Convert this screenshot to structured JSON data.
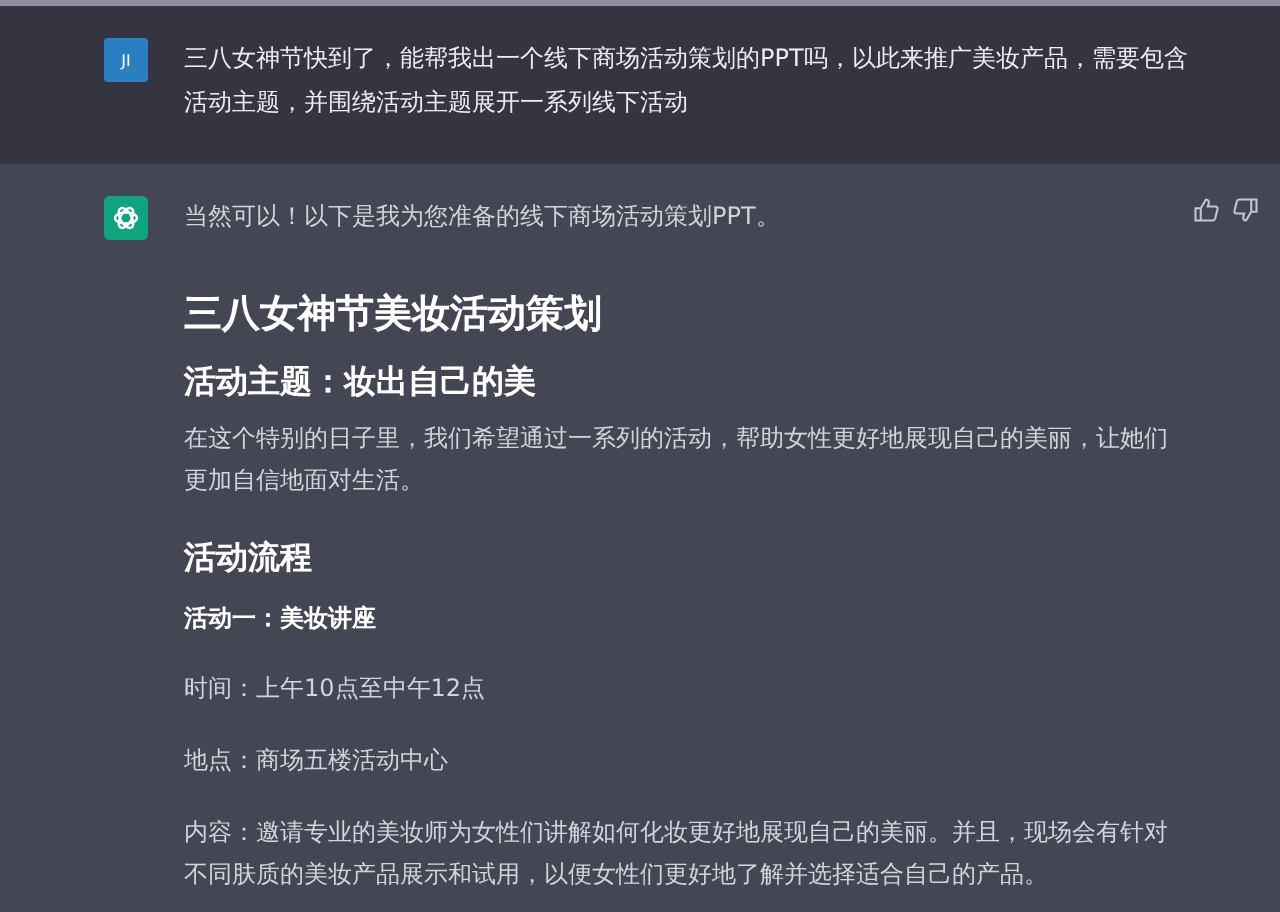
{
  "user_message": {
    "avatar": "JI",
    "text": "三八女神节快到了，能帮我出一个线下商场活动策划的PPT吗，以此来推广美妆产品，需要包含活动主题，并围绕活动主题展开一系列线下活动"
  },
  "assistant_message": {
    "intro": "当然可以！以下是我为您准备的线下商场活动策划PPT。",
    "blocks": [
      {
        "kind": "h1",
        "text": "三八女神节美妆活动策划"
      },
      {
        "kind": "h2",
        "text": "活动主题：妆出自己的美"
      },
      {
        "kind": "p",
        "text": "在这个特别的日子里，我们希望通过一系列的活动，帮助女性更好地展现自己的美丽，让她们更加自信地面对生活。"
      },
      {
        "kind": "h2",
        "text": "活动流程"
      },
      {
        "kind": "strong",
        "text": "活动一：美妆讲座"
      },
      {
        "kind": "p",
        "text": "时间：上午10点至中午12点"
      },
      {
        "kind": "p",
        "text": "地点：商场五楼活动中心"
      },
      {
        "kind": "p",
        "text": "内容：邀请专业的美妆师为女性们讲解如何化妆更好地展现自己的美丽。并且，现场会有针对不同肤质的美妆产品展示和试用，以便女性们更好地了解并选择适合自己的产品。"
      }
    ]
  }
}
